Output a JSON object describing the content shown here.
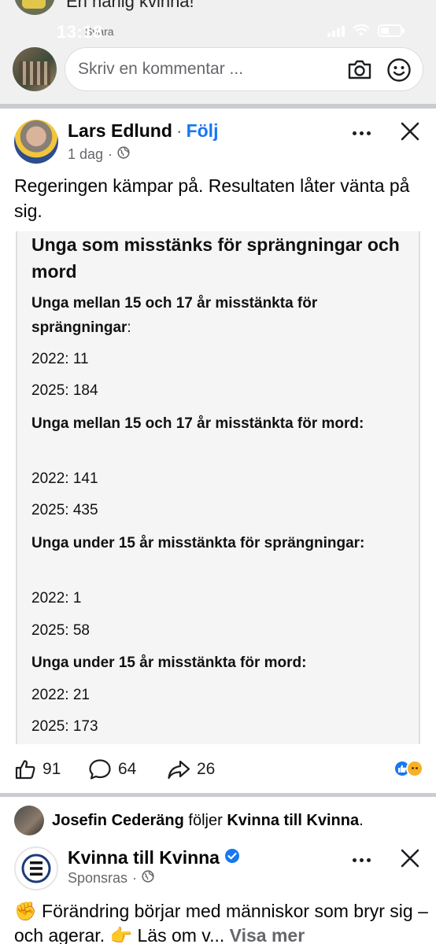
{
  "status_bar": {
    "time": "13:18",
    "under_text": "Svara"
  },
  "previous_comment": {
    "text": "En härlig kvinna!"
  },
  "comment_box": {
    "placeholder": "Skriv en kommentar ..."
  },
  "post": {
    "author": "Lars Edlund",
    "separator": "·",
    "follow_label": "Följ",
    "time": "1 dag",
    "meta_separator": "·",
    "text": "Regeringen kämpar på. Resultaten låter vänta på sig.",
    "card": {
      "title": "Unga som misstänks för sprängningar och mord",
      "sections": [
        {
          "heading": "Unga mellan 15 och 17 år misstänkta för sprängningar",
          "colon": ":",
          "values": [
            "2022: 11",
            "2025: 184"
          ]
        },
        {
          "heading": "Unga mellan 15 och 17 år misstänkta för mord:",
          "colon": "",
          "values": [
            "2022: 141",
            "2025: 435"
          ]
        },
        {
          "heading": "Unga under 15 år misstänkta för sprängningar:",
          "colon": "",
          "values": [
            "2022: 1",
            "2025: 58"
          ]
        },
        {
          "heading": "Unga under 15 år misstänkta för mord:",
          "colon": "",
          "values": [
            "2022: 21",
            "2025: 173"
          ]
        }
      ]
    },
    "reactions": {
      "likes": "91",
      "comments": "64",
      "shares": "26"
    }
  },
  "next_story": {
    "friend_name": "Josefin Cederäng",
    "friend_action": "följer",
    "page_name": "Kvinna till Kvinna",
    "friend_end": ".",
    "org_name": "Kvinna till Kvinna",
    "sponsored_label": "Sponsras",
    "meta_separator": "·",
    "text": "✊ Förändring börjar med människor som bryr sig – och agerar. 👉 Läs om v...",
    "see_more": "Visa mer"
  },
  "colors": {
    "accent": "#1877f2",
    "text": "#050505",
    "secondary": "#65676b",
    "card_bg": "#f5f5f5"
  }
}
